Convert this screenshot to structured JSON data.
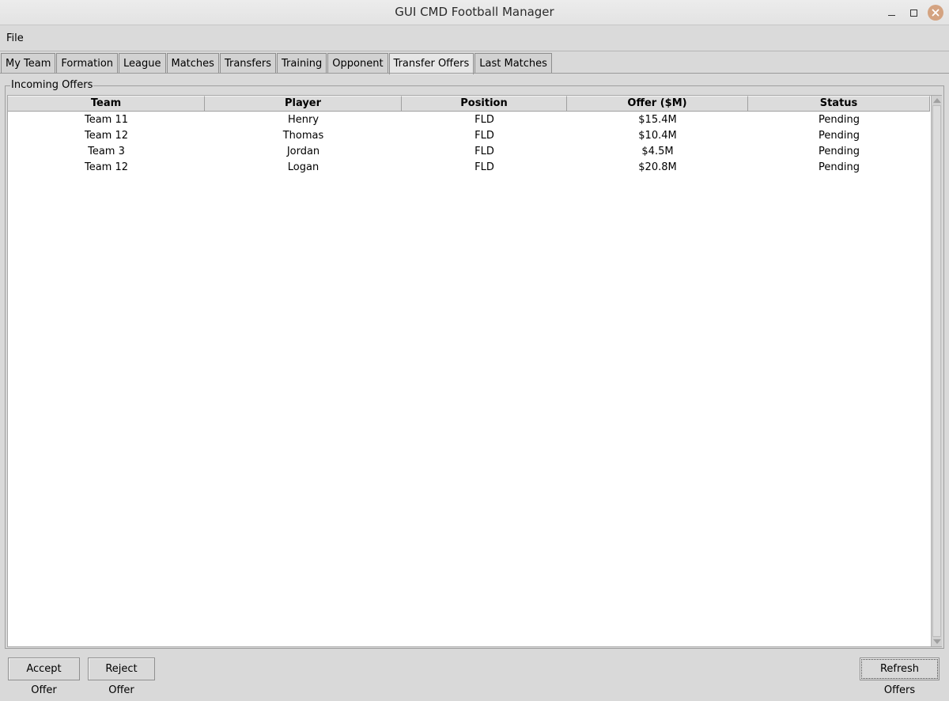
{
  "window": {
    "title": "GUI CMD Football Manager"
  },
  "menu": {
    "file": "File"
  },
  "tabs": [
    {
      "label": "My Team"
    },
    {
      "label": "Formation"
    },
    {
      "label": "League"
    },
    {
      "label": "Matches"
    },
    {
      "label": "Transfers"
    },
    {
      "label": "Training"
    },
    {
      "label": "Opponent"
    },
    {
      "label": "Transfer Offers",
      "active": true
    },
    {
      "label": "Last Matches"
    }
  ],
  "offers": {
    "group_title": "Incoming Offers",
    "columns": [
      "Team",
      "Player",
      "Position",
      "Offer ($M)",
      "Status"
    ],
    "rows": [
      [
        "Team 11",
        "Henry",
        "FLD",
        "$15.4M",
        "Pending"
      ],
      [
        "Team 12",
        "Thomas",
        "FLD",
        "$10.4M",
        "Pending"
      ],
      [
        "Team 3",
        "Jordan",
        "FLD",
        "$4.5M",
        "Pending"
      ],
      [
        "Team 12",
        "Logan",
        "FLD",
        "$20.8M",
        "Pending"
      ]
    ]
  },
  "buttons": {
    "accept": "Accept Offer",
    "reject": "Reject Offer",
    "refresh": "Refresh Offers"
  }
}
